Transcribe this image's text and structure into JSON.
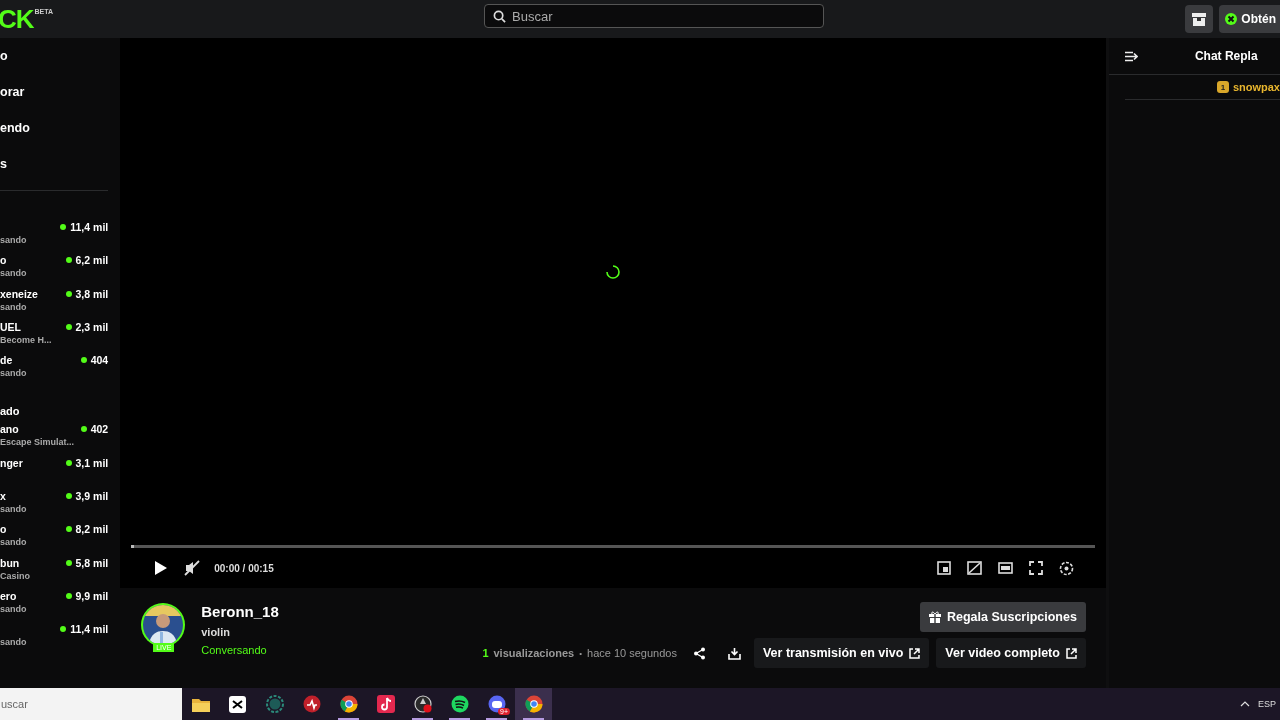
{
  "header": {
    "logo": "CK",
    "logo_badge": "BETA",
    "search": {
      "placeholder": "Buscar"
    },
    "get_button": "Obtén"
  },
  "sidebar": {
    "nav": [
      {
        "label": "o"
      },
      {
        "label": "orar"
      },
      {
        "label": "endo"
      },
      {
        "label": "s"
      }
    ],
    "sections": [
      {
        "channels": [
          {
            "subtitle": "sando",
            "viewers": "11,4 mil"
          },
          {
            "name": "o",
            "subtitle": "sando",
            "viewers": "6,2 mil"
          },
          {
            "name": "xeneize",
            "subtitle": "sando",
            "viewers": "3,8 mil"
          },
          {
            "name": "UEL",
            "subtitle": "Become H...",
            "viewers": "2,3 mil"
          },
          {
            "name": "de",
            "subtitle": "sando",
            "viewers": "404"
          }
        ]
      },
      {
        "heading": "ado",
        "channels": [
          {
            "name": "ano",
            "subtitle": "Escape Simulat...",
            "viewers": "402"
          },
          {
            "name": "nger",
            "viewers": "3,1 mil"
          },
          {
            "name": "x",
            "subtitle": "sando",
            "viewers": "3,9 mil"
          },
          {
            "name": "o",
            "subtitle": "sando",
            "viewers": "8,2 mil"
          },
          {
            "name": "bun",
            "subtitle": "Casino",
            "viewers": "5,8 mil"
          },
          {
            "name": "ero",
            "subtitle": "sando",
            "viewers": "9,9 mil"
          },
          {
            "subtitle": "sando",
            "viewers": "11,4 mil"
          }
        ]
      }
    ]
  },
  "player": {
    "time": "00:00 / 00:15",
    "loading": true,
    "progress": {
      "level": 0
    }
  },
  "stream": {
    "channel": "Beronn_18",
    "title": "violin",
    "category": "Conversando",
    "live_badge": "LIVE",
    "views_count": "1",
    "views_label": "visualizaciones",
    "separator": "•",
    "age": "hace 10 segundos",
    "gift_button": "Regala Suscripciones",
    "live_button": "Ver transmisión en vivo",
    "full_button": "Ver video completo"
  },
  "chat": {
    "title": "Chat Repla",
    "messages": [
      {
        "badge": "1",
        "user": "snowpax"
      }
    ]
  },
  "taskbar": {
    "search": {
      "placeholder": "uscar"
    },
    "apps": [
      {
        "kind": "folder",
        "running": false,
        "selected": false
      },
      {
        "kind": "cut",
        "running": false,
        "selected": false
      },
      {
        "kind": "ring",
        "running": false,
        "selected": false
      },
      {
        "kind": "redapp",
        "running": false,
        "selected": false
      },
      {
        "kind": "browser",
        "running": true,
        "selected": false
      },
      {
        "kind": "note",
        "running": false,
        "selected": false
      },
      {
        "kind": "recorder",
        "running": true,
        "selected": false
      },
      {
        "kind": "music",
        "running": true,
        "selected": false
      },
      {
        "kind": "chat",
        "running": true,
        "selected": false,
        "badge": "9+"
      },
      {
        "kind": "browser",
        "running": true,
        "selected": true
      }
    ],
    "language": "ESP"
  }
}
